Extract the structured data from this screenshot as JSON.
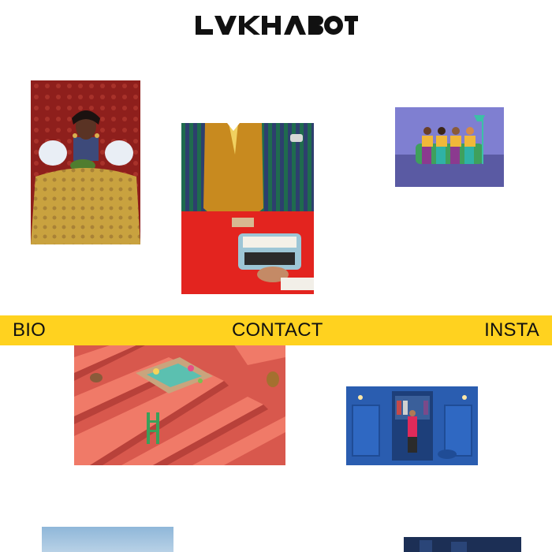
{
  "site": {
    "logo_text": "LVKHABOT",
    "accent_color": "#ffd21f"
  },
  "nav": {
    "bio_label": "BIO",
    "contact_label": "CONTACT",
    "insta_label": "INSTA"
  },
  "gallery": [
    {
      "name": "woman-with-pink-ruffles"
    },
    {
      "name": "mustard-suit-typewriter"
    },
    {
      "name": "group-on-green-sofa"
    },
    {
      "name": "red-maze-with-fountain"
    },
    {
      "name": "blue-wardrobe-room"
    },
    {
      "name": "sky-photo"
    },
    {
      "name": "dark-blue-photo"
    }
  ]
}
